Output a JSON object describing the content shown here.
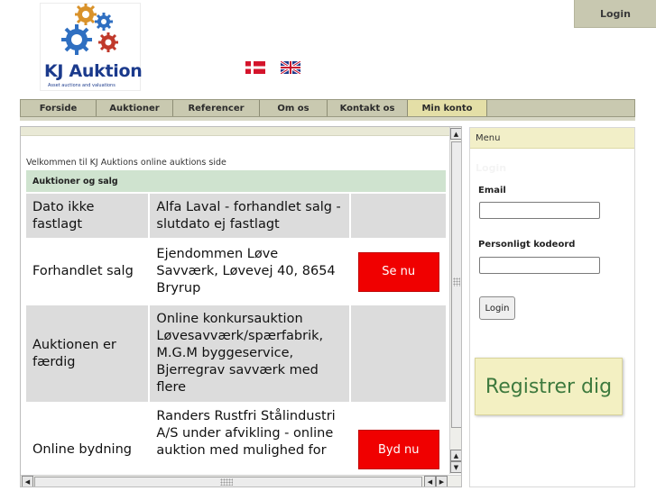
{
  "header": {
    "login_tab": "Login",
    "logo_text": "KJ Auktion",
    "logo_subtitle": "Asset auctions and valuations"
  },
  "icons": {
    "flag_dk": "danish-flag-icon",
    "flag_uk": "uk-flag-icon",
    "logo": "gears-logo-icon"
  },
  "nav": {
    "items": [
      {
        "label": "Forside"
      },
      {
        "label": "Auktioner"
      },
      {
        "label": "Referencer"
      },
      {
        "label": "Om os"
      },
      {
        "label": "Kontakt os"
      },
      {
        "label": "Min konto"
      }
    ],
    "active": "Min konto"
  },
  "main": {
    "welcome": "Velkommen til KJ Auktions online auktions side",
    "section_title": "Auktioner og salg",
    "rows": [
      {
        "status": "Dato ikke fastlagt",
        "title": "Alfa Laval - forhandlet salg - slutdato ej fastlagt",
        "action": ""
      },
      {
        "status": "Forhandlet salg",
        "title": "Ejendommen Løve Savværk, Løvevej 40, 8654 Bryrup",
        "action": "Se nu"
      },
      {
        "status": "Auktionen er færdig",
        "title": "Online konkursauktion Løvesavværk/spærfabrik, M.G.M byggeservice, Bjerregrav savværk med flere",
        "action": ""
      },
      {
        "status": "Online bydning",
        "title": "Randers Rustfri Stålindustri A/S under afvikling - online auktion med mulighed for",
        "action": "Byd nu"
      }
    ]
  },
  "sidebar": {
    "menu_title": "Menu",
    "login_title": "Login",
    "email_label": "Email",
    "password_label": "Personligt kodeord",
    "login_button": "Login",
    "register_button": "Registrer dig"
  },
  "colors": {
    "accent_red": "#f00000",
    "nav_bg": "#c9c9b0",
    "nav_active": "#e4dfa7",
    "section_green": "#cfe3cf",
    "register_text": "#3e7a3e"
  }
}
